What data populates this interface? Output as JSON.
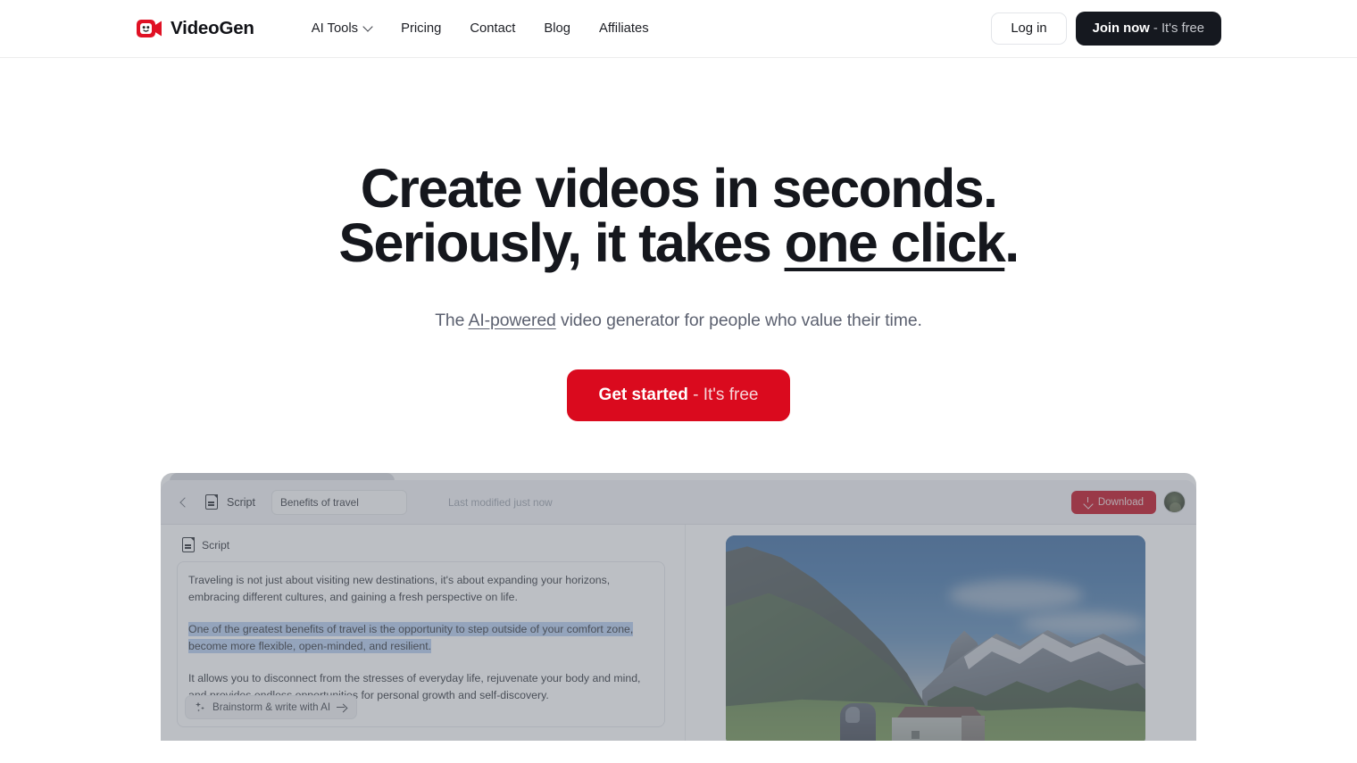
{
  "navbar": {
    "brand": {
      "name": "VideoGen",
      "icon": "video-camera-face-icon",
      "color": "#e01124"
    },
    "links": [
      {
        "label": "AI Tools",
        "has_chevron": true,
        "icon": "chevron-down-icon"
      },
      {
        "label": "Pricing",
        "has_chevron": false
      },
      {
        "label": "Contact",
        "has_chevron": false
      },
      {
        "label": "Blog",
        "has_chevron": false
      },
      {
        "label": "Affiliates",
        "has_chevron": false
      }
    ],
    "login_label": "Log in",
    "join_bold": "Join now",
    "join_soft": "- It's free"
  },
  "hero": {
    "headline_line1": "Create videos in seconds.",
    "headline_line2_pre": "Seriously, it takes ",
    "headline_line2_underlined": "one click",
    "headline_line2_post": ".",
    "sub_pre": "The ",
    "sub_underlined": "AI-powered",
    "sub_post": " video generator for people who value their time.",
    "cta_bold": "Get started",
    "cta_soft": "- It's free",
    "cta_color": "#da0a1e"
  },
  "app": {
    "topbar": {
      "back_icon": "chevron-left-icon",
      "doc_icon": "document-icon",
      "label": "Script",
      "title_value": "Benefits of travel",
      "title_placeholder": "Untitled",
      "last_modified": "Last modified just now",
      "download_label": "Download",
      "download_icon": "download-icon",
      "avatar": "user-avatar"
    },
    "editor": {
      "section_icon": "document-icon",
      "section_label": "Script",
      "paragraphs": [
        {
          "text": "Traveling is not just about visiting new destinations, it's about expanding your horizons, embracing different cultures, and gaining a fresh perspective on life.",
          "selected": false
        },
        {
          "text": "One of the greatest benefits of travel is the opportunity to step outside of your comfort zone, become more flexible, open-minded, and resilient.",
          "selected": true
        },
        {
          "text": "It allows you to disconnect from the stresses of everyday life, rejuvenate your body and mind, and provides endless opportunities for personal growth and self-discovery.",
          "selected": false
        }
      ],
      "ai_button_label": "Brainstorm & write with AI",
      "ai_button_icon": "sparkles-icon",
      "ai_button_arrow": "arrow-right-icon",
      "selection_color": "#b5cdf0"
    },
    "preview": {
      "media": "mountain-landscape-photo",
      "description": "Alpine scene: blue sky, dark forested ridge at left, snow-capped rocky peaks at right, green meadow with a chalet house and a person in the foreground"
    }
  }
}
